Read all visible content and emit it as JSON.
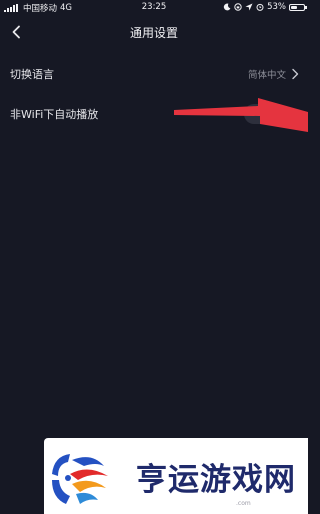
{
  "status_bar": {
    "carrier": "中国移动",
    "network": "4G",
    "time": "23:25",
    "battery": "53%",
    "battery_level": 0.53
  },
  "nav": {
    "title": "通用设置",
    "back_icon": "chevron-left-icon"
  },
  "settings": {
    "language": {
      "label": "切换语言",
      "value": "简体中文"
    },
    "autoplay": {
      "label": "非WiFi下自动播放",
      "enabled": true
    }
  },
  "annotation": {
    "type": "arrow",
    "color": "#e5343f"
  },
  "watermark": {
    "text": "亨运游戏网",
    "domain": ".com"
  },
  "colors": {
    "background": "#161824",
    "toggle_track": "#2d2f3c",
    "muted_text": "#8c8e98"
  }
}
